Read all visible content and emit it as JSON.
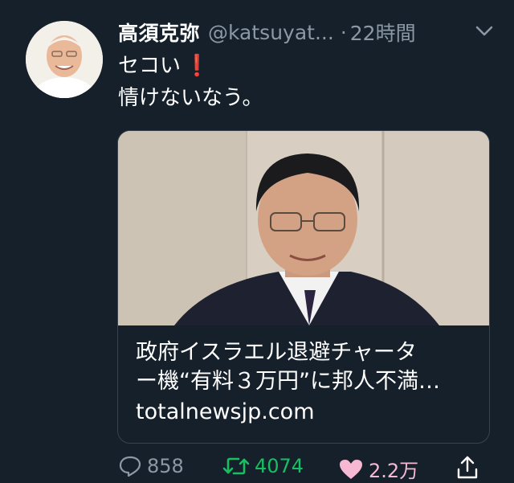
{
  "tweet": {
    "author_name": "高須克弥",
    "author_handle": "@katsuyat...",
    "separator": "·",
    "time": "22時間",
    "text_line1": "セコい",
    "text_emoji": "❗",
    "text_line2": "情けないなう。"
  },
  "card": {
    "title_line1": "政府イスラエル退避チャータ",
    "title_line2": "ー機“有料３万円”に邦人不満…",
    "domain": "totalnewsjp.com"
  },
  "actions": {
    "replies": "858",
    "retweets": "4074",
    "likes": "2.2万"
  },
  "colors": {
    "background": "#15202b",
    "secondary_text": "#8b98a5",
    "retweet": "#17bf63",
    "like": "#e0245e",
    "border": "#38444d"
  },
  "icons": [
    "chevron-down-icon",
    "reply-icon",
    "retweet-icon",
    "like-icon",
    "share-icon"
  ]
}
